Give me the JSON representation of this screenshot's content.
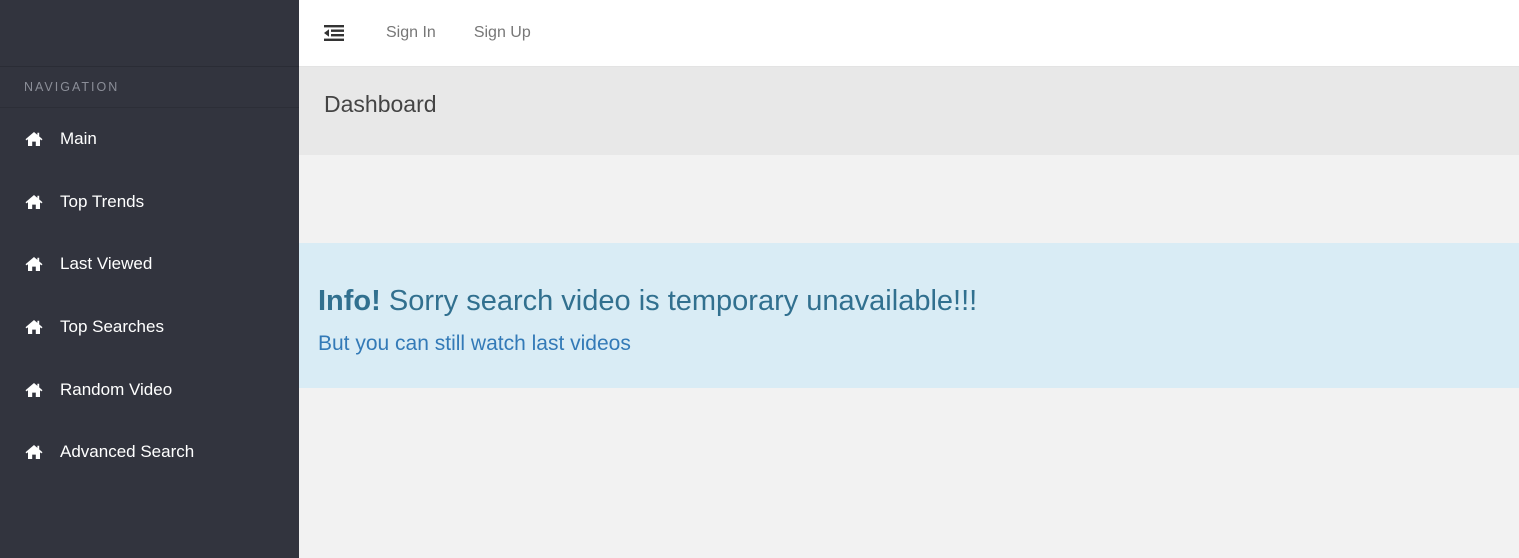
{
  "sidebar": {
    "heading": "NAVIGATION",
    "items": [
      {
        "label": "Main",
        "icon": "home-icon"
      },
      {
        "label": "Top Trends",
        "icon": "home-icon"
      },
      {
        "label": "Last Viewed",
        "icon": "home-icon"
      },
      {
        "label": "Top Searches",
        "icon": "home-icon"
      },
      {
        "label": "Random Video",
        "icon": "home-icon"
      },
      {
        "label": "Advanced Search",
        "icon": "home-icon"
      }
    ]
  },
  "topbar": {
    "toggle_icon": "menu-toggle-icon",
    "sign_in": "Sign In",
    "sign_up": "Sign Up"
  },
  "page": {
    "title": "Dashboard"
  },
  "alert": {
    "prefix": "Info!",
    "message": " Sorry search video is temporary unavailable!!!",
    "subtext": "But you can still watch last videos"
  },
  "colors": {
    "sidebar_bg": "#32343e",
    "alert_bg": "#d9ecf5",
    "alert_text": "#31708f",
    "alert_link": "#337ab7",
    "header_bg": "#e8e8e8",
    "content_bg": "#f2f2f2"
  }
}
